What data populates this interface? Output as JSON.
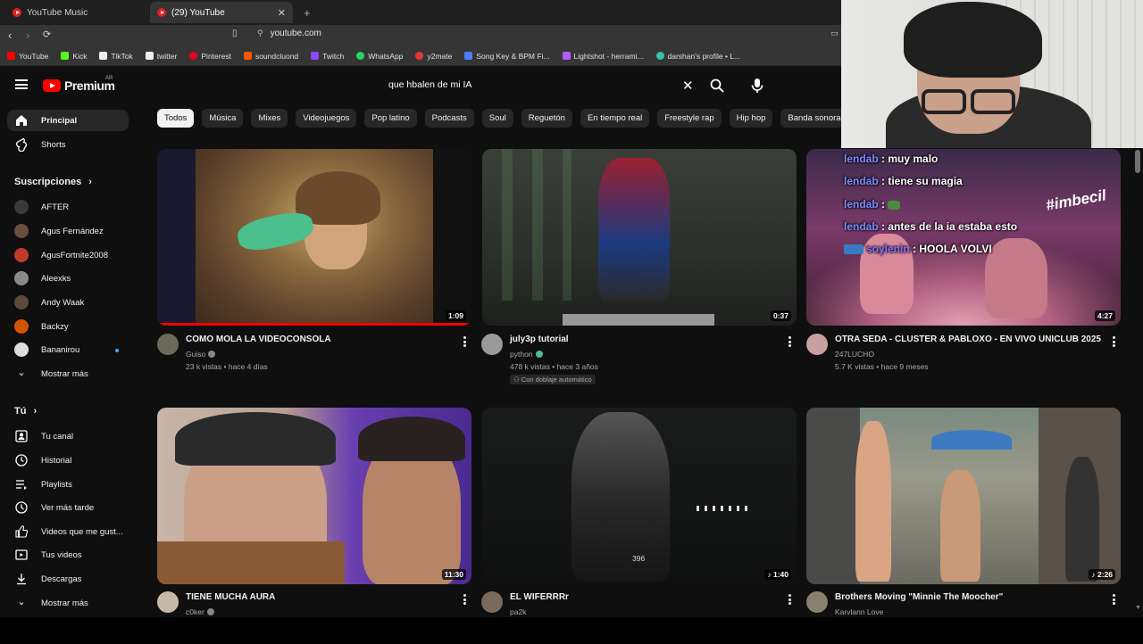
{
  "browser": {
    "tabs": [
      {
        "title": "YouTube Music"
      },
      {
        "title": "(29) YouTube"
      }
    ],
    "url": "youtube.com",
    "bookmarks": [
      {
        "label": "YouTube",
        "color": "#ff0000"
      },
      {
        "label": "Kick",
        "color": "#53fc18"
      },
      {
        "label": "TikTok",
        "color": "#ffffff"
      },
      {
        "label": "twitter",
        "color": "#ffffff"
      },
      {
        "label": "Pinterest",
        "color": "#e60023"
      },
      {
        "label": "soundcluond",
        "color": "#ff5500"
      },
      {
        "label": "Twitch",
        "color": "#9146ff"
      },
      {
        "label": "WhatsApp",
        "color": "#25d366"
      },
      {
        "label": "y2mate",
        "color": "#e53935"
      },
      {
        "label": "Song Key & BPM Fi...",
        "color": "#4f7cff"
      },
      {
        "label": "Lightshot - herrami...",
        "color": "#b25bff"
      },
      {
        "label": "darshan's profile • L...",
        "color": "#36c3ad"
      }
    ]
  },
  "header": {
    "logo": "Premium",
    "region": "AR",
    "search_value": "que hbalen de mi  IA"
  },
  "chips": [
    "Todos",
    "Música",
    "Mixes",
    "Videojuegos",
    "Pop latino",
    "Podcasts",
    "Soul",
    "Reguetón",
    "En tiempo real",
    "Freestyle rap",
    "Hip hop",
    "Banda sonora"
  ],
  "sidebar": {
    "principal": "Principal",
    "shorts": "Shorts",
    "subs_heading": "Suscripciones",
    "subscriptions": [
      {
        "name": "AFTER",
        "color": "#3a3a3a"
      },
      {
        "name": "Agus Fernández",
        "color": "#6b4e3d"
      },
      {
        "name": "AgusFortnite2008",
        "color": "#c0392b"
      },
      {
        "name": "Aleexks",
        "color": "#8a8a8a"
      },
      {
        "name": "Andy Waak",
        "color": "#5c4a3a"
      },
      {
        "name": "Backzy",
        "color": "#d35400"
      },
      {
        "name": "Bananirou",
        "color": "#dddddd"
      }
    ],
    "show_more": "Mostrar más",
    "you_heading": "Tú",
    "you_items": [
      "Tu canal",
      "Historial",
      "Playlists",
      "Ver más tarde",
      "Videos que me gust...",
      "Tus videos",
      "Descargas"
    ],
    "show_more_2": "Mostrar más"
  },
  "videos": [
    {
      "title": "COMO MOLA LA VIDEOCONSOLA",
      "channel": "Guiso",
      "meta": "23 k vistas • hace 4 días",
      "duration": "1:09",
      "progress": 1.0
    },
    {
      "title": "july3p tutorial",
      "channel": "python",
      "meta": "478 k vistas • hace 3 años",
      "badge": "Con doblaje automático",
      "duration": "0:37"
    },
    {
      "title": "OTRA SEDA - CLUSTER & PABLOXO - EN VIVO UNICLUB 2025",
      "channel": "247LUCHO",
      "meta": "5.7 K vistas • hace 9 meses",
      "duration": "4:27"
    },
    {
      "title": "TIENE MUCHA AURA",
      "channel": "c0ker",
      "duration": "11:30"
    },
    {
      "title": "EL WIFERRRr",
      "channel": "pa2k",
      "duration": "1:40",
      "overlay": "396"
    },
    {
      "title": "Brothers Moving \"Minnie The Moocher\"",
      "channel": "Karvlann Love",
      "duration": "2:26"
    }
  ],
  "chat": [
    {
      "user": "lendab",
      "message": "muy malo"
    },
    {
      "user": "lendab",
      "message": "tiene su magia"
    },
    {
      "user": "lendab",
      "message": ""
    },
    {
      "user": "lendab",
      "message": "antes de la ia estaba esto"
    },
    {
      "user": "soylenin",
      "message": "HOOLA VOLVI"
    }
  ],
  "overlay_text": "#imbecil"
}
